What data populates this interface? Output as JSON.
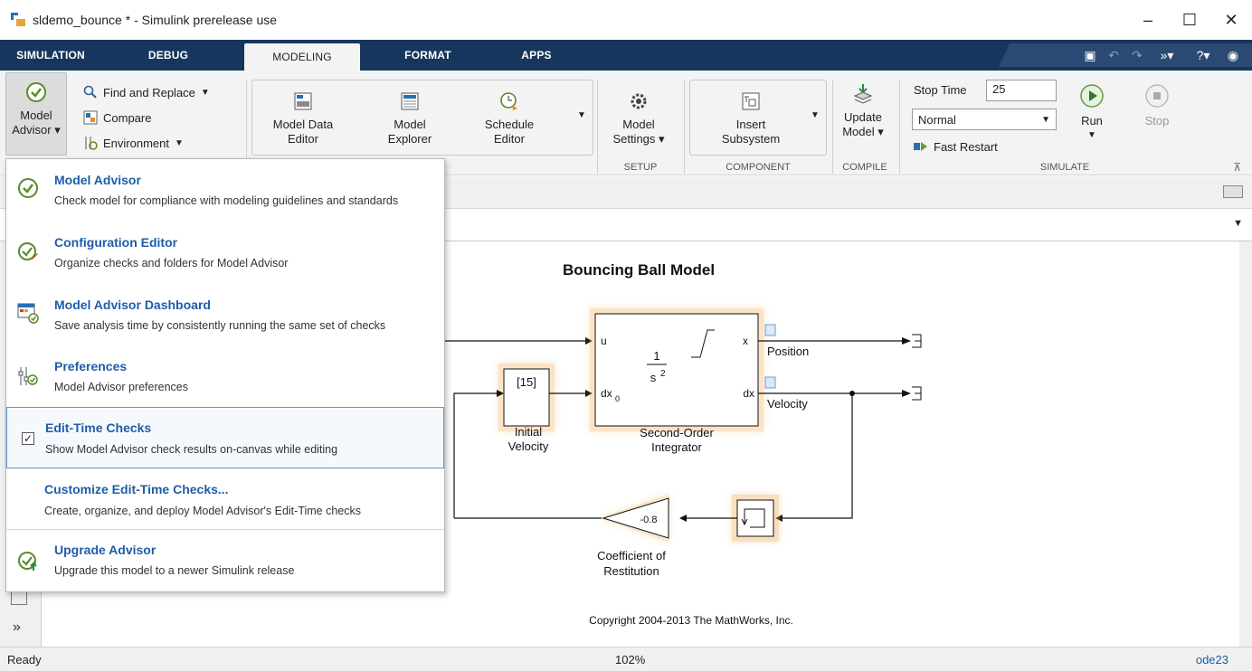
{
  "window": {
    "title": "sldemo_bounce * - Simulink prerelease use",
    "minimize": "–",
    "maximize": "☐",
    "close": "✕"
  },
  "tabs": [
    {
      "label": "SIMULATION"
    },
    {
      "label": "DEBUG"
    },
    {
      "label": "MODELING"
    },
    {
      "label": "FORMAT"
    },
    {
      "label": "APPS"
    }
  ],
  "ribbon": {
    "model_advisor_l1": "Model",
    "model_advisor_l2": "Advisor ▾",
    "find_replace": "Find and Replace",
    "compare": "Compare",
    "environment": "Environment",
    "model_data_editor_l1": "Model Data",
    "model_data_editor_l2": "Editor",
    "model_explorer_l1": "Model",
    "model_explorer_l2": "Explorer",
    "schedule_editor_l1": "Schedule",
    "schedule_editor_l2": "Editor",
    "model_settings_l1": "Model",
    "model_settings_l2": "Settings ▾",
    "setup_label": "SETUP",
    "insert_subsystem_l1": "Insert",
    "insert_subsystem_l2": "Subsystem",
    "component_label": "COMPONENT",
    "update_model_l1": "Update",
    "update_model_l2": "Model ▾",
    "compile_label": "COMPILE",
    "stop_time_label": "Stop Time",
    "stop_time_value": "25",
    "sim_mode": "Normal",
    "fast_restart": "Fast Restart",
    "run": "Run",
    "stop": "Stop",
    "simulate_label": "SIMULATE"
  },
  "menu": {
    "items": [
      {
        "title": "Model Advisor",
        "desc": "Check model for compliance with modeling guidelines and standards"
      },
      {
        "title": "Configuration Editor",
        "desc": "Organize checks and folders for Model Advisor"
      },
      {
        "title": "Model Advisor Dashboard",
        "desc": "Save analysis time by consistently running the same set of checks"
      },
      {
        "title": "Preferences",
        "desc": "Model Advisor preferences"
      },
      {
        "title": "Edit-Time Checks",
        "desc": "Show Model Advisor check results on-canvas while editing",
        "checked": true
      },
      {
        "title": "Customize Edit-Time Checks...",
        "desc": "Create, organize, and deploy Model Advisor's Edit-Time checks"
      },
      {
        "title": "Upgrade Advisor",
        "desc": "Upgrade this model to a newer Simulink release"
      }
    ]
  },
  "diagram": {
    "title": "Bouncing Ball Model",
    "initial_value": "[15]",
    "initial_label_1": "Initial",
    "initial_label_2": "Velocity",
    "integrator_num": "1",
    "integrator_den": "s",
    "integrator_den_exp": "2",
    "port_u": "u",
    "port_dx0": "dx",
    "port_dx0_sub": "0",
    "port_x": "x",
    "port_dx": "dx",
    "integrator_label_1": "Second-Order",
    "integrator_label_2": "Integrator",
    "position_label": "Position",
    "velocity_label": "Velocity",
    "gain_value": "-0.8",
    "gain_label_1": "Coefficient of",
    "gain_label_2": "Restitution",
    "copyright": "Copyright 2004-2013 The MathWorks, Inc."
  },
  "status": {
    "state": "Ready",
    "zoom": "102%",
    "solver": "ode23"
  },
  "colors": {
    "tabstrip": "#17365d",
    "link": "#1f5da8",
    "glow": "#f0a040"
  }
}
